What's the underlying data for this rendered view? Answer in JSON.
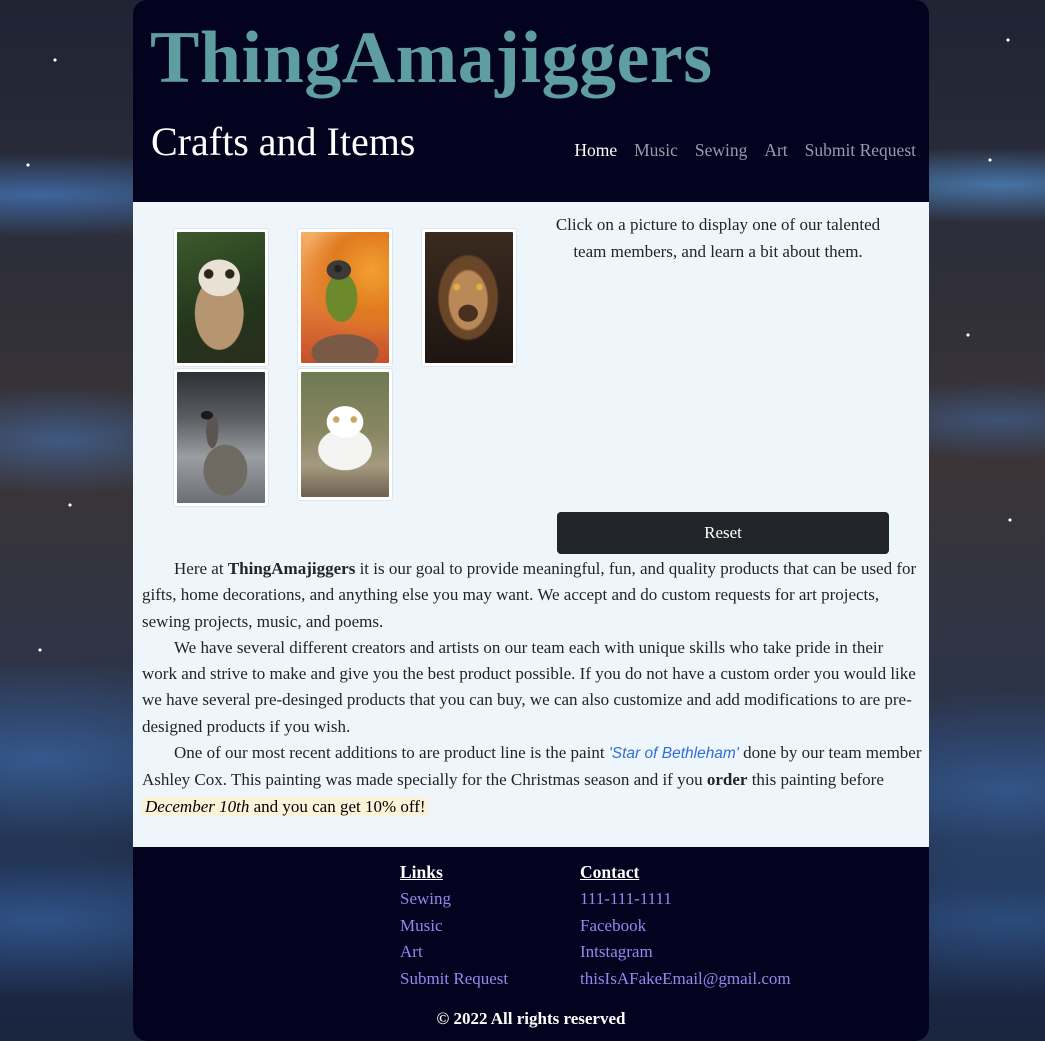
{
  "header": {
    "brand_title": "ThingAmajiggers",
    "subtitle": "Crafts and Items",
    "nav": [
      {
        "label": "Home",
        "active": true
      },
      {
        "label": "Music"
      },
      {
        "label": "Sewing"
      },
      {
        "label": "Art"
      },
      {
        "label": "Submit Request"
      }
    ]
  },
  "gallery": {
    "instructions": "Click on a picture to display one of our talented team members, and learn a bit about them.",
    "images": [
      {
        "subject": "owl"
      },
      {
        "subject": "parrot"
      },
      {
        "subject": "lion"
      },
      {
        "subject": "goose"
      },
      {
        "subject": "cat"
      }
    ],
    "reset_label": "Reset"
  },
  "about": {
    "p1_before": "Here at ",
    "p1_brand": "ThingAmajiggers",
    "p1_after": " it is our goal to provide meaningful, fun, and quality products that can be used for gifts, home decorations, and anything else you may want. We accept and do custom requests for art projects, sewing projects, music, and poems.",
    "p2": "We have several different creators and artists on our team each with unique skills who take pride in their work and strive to make and give you the best product possible. If you do not have a custom order you would like we have several pre-desinged products that you can buy, we can also customize and add modifications to are pre-designed products if you wish.",
    "p3_before": "One of our most recent additions to are product line is the paint ",
    "p3_painting": "'Star of Bethleham'",
    "p3_middle": " done by our team member Ashley Cox. This painting was made specially for the Christmas season and if you ",
    "p3_order": "order",
    "p3_after_order": " this painting before ",
    "p3_date": "December 10th",
    "p3_discount": " and you can get 10% off!"
  },
  "footer": {
    "links_heading": "Links",
    "links": [
      "Sewing",
      "Music",
      "Art",
      "Submit Request"
    ],
    "contact_heading": "Contact",
    "contact": [
      "111-111-1111",
      "Facebook",
      "Intstagram",
      "thisIsAFakeEmail@gmail.com"
    ],
    "copyright": "© 2022 All rights reserved"
  },
  "colors": {
    "header_bg": "#03031f",
    "brand_title": "#5f9ea0",
    "content_bg": "#eef6fc",
    "button_bg": "#212529",
    "footer_link": "#9a85f0",
    "painting_link": "#2f6fd3"
  }
}
